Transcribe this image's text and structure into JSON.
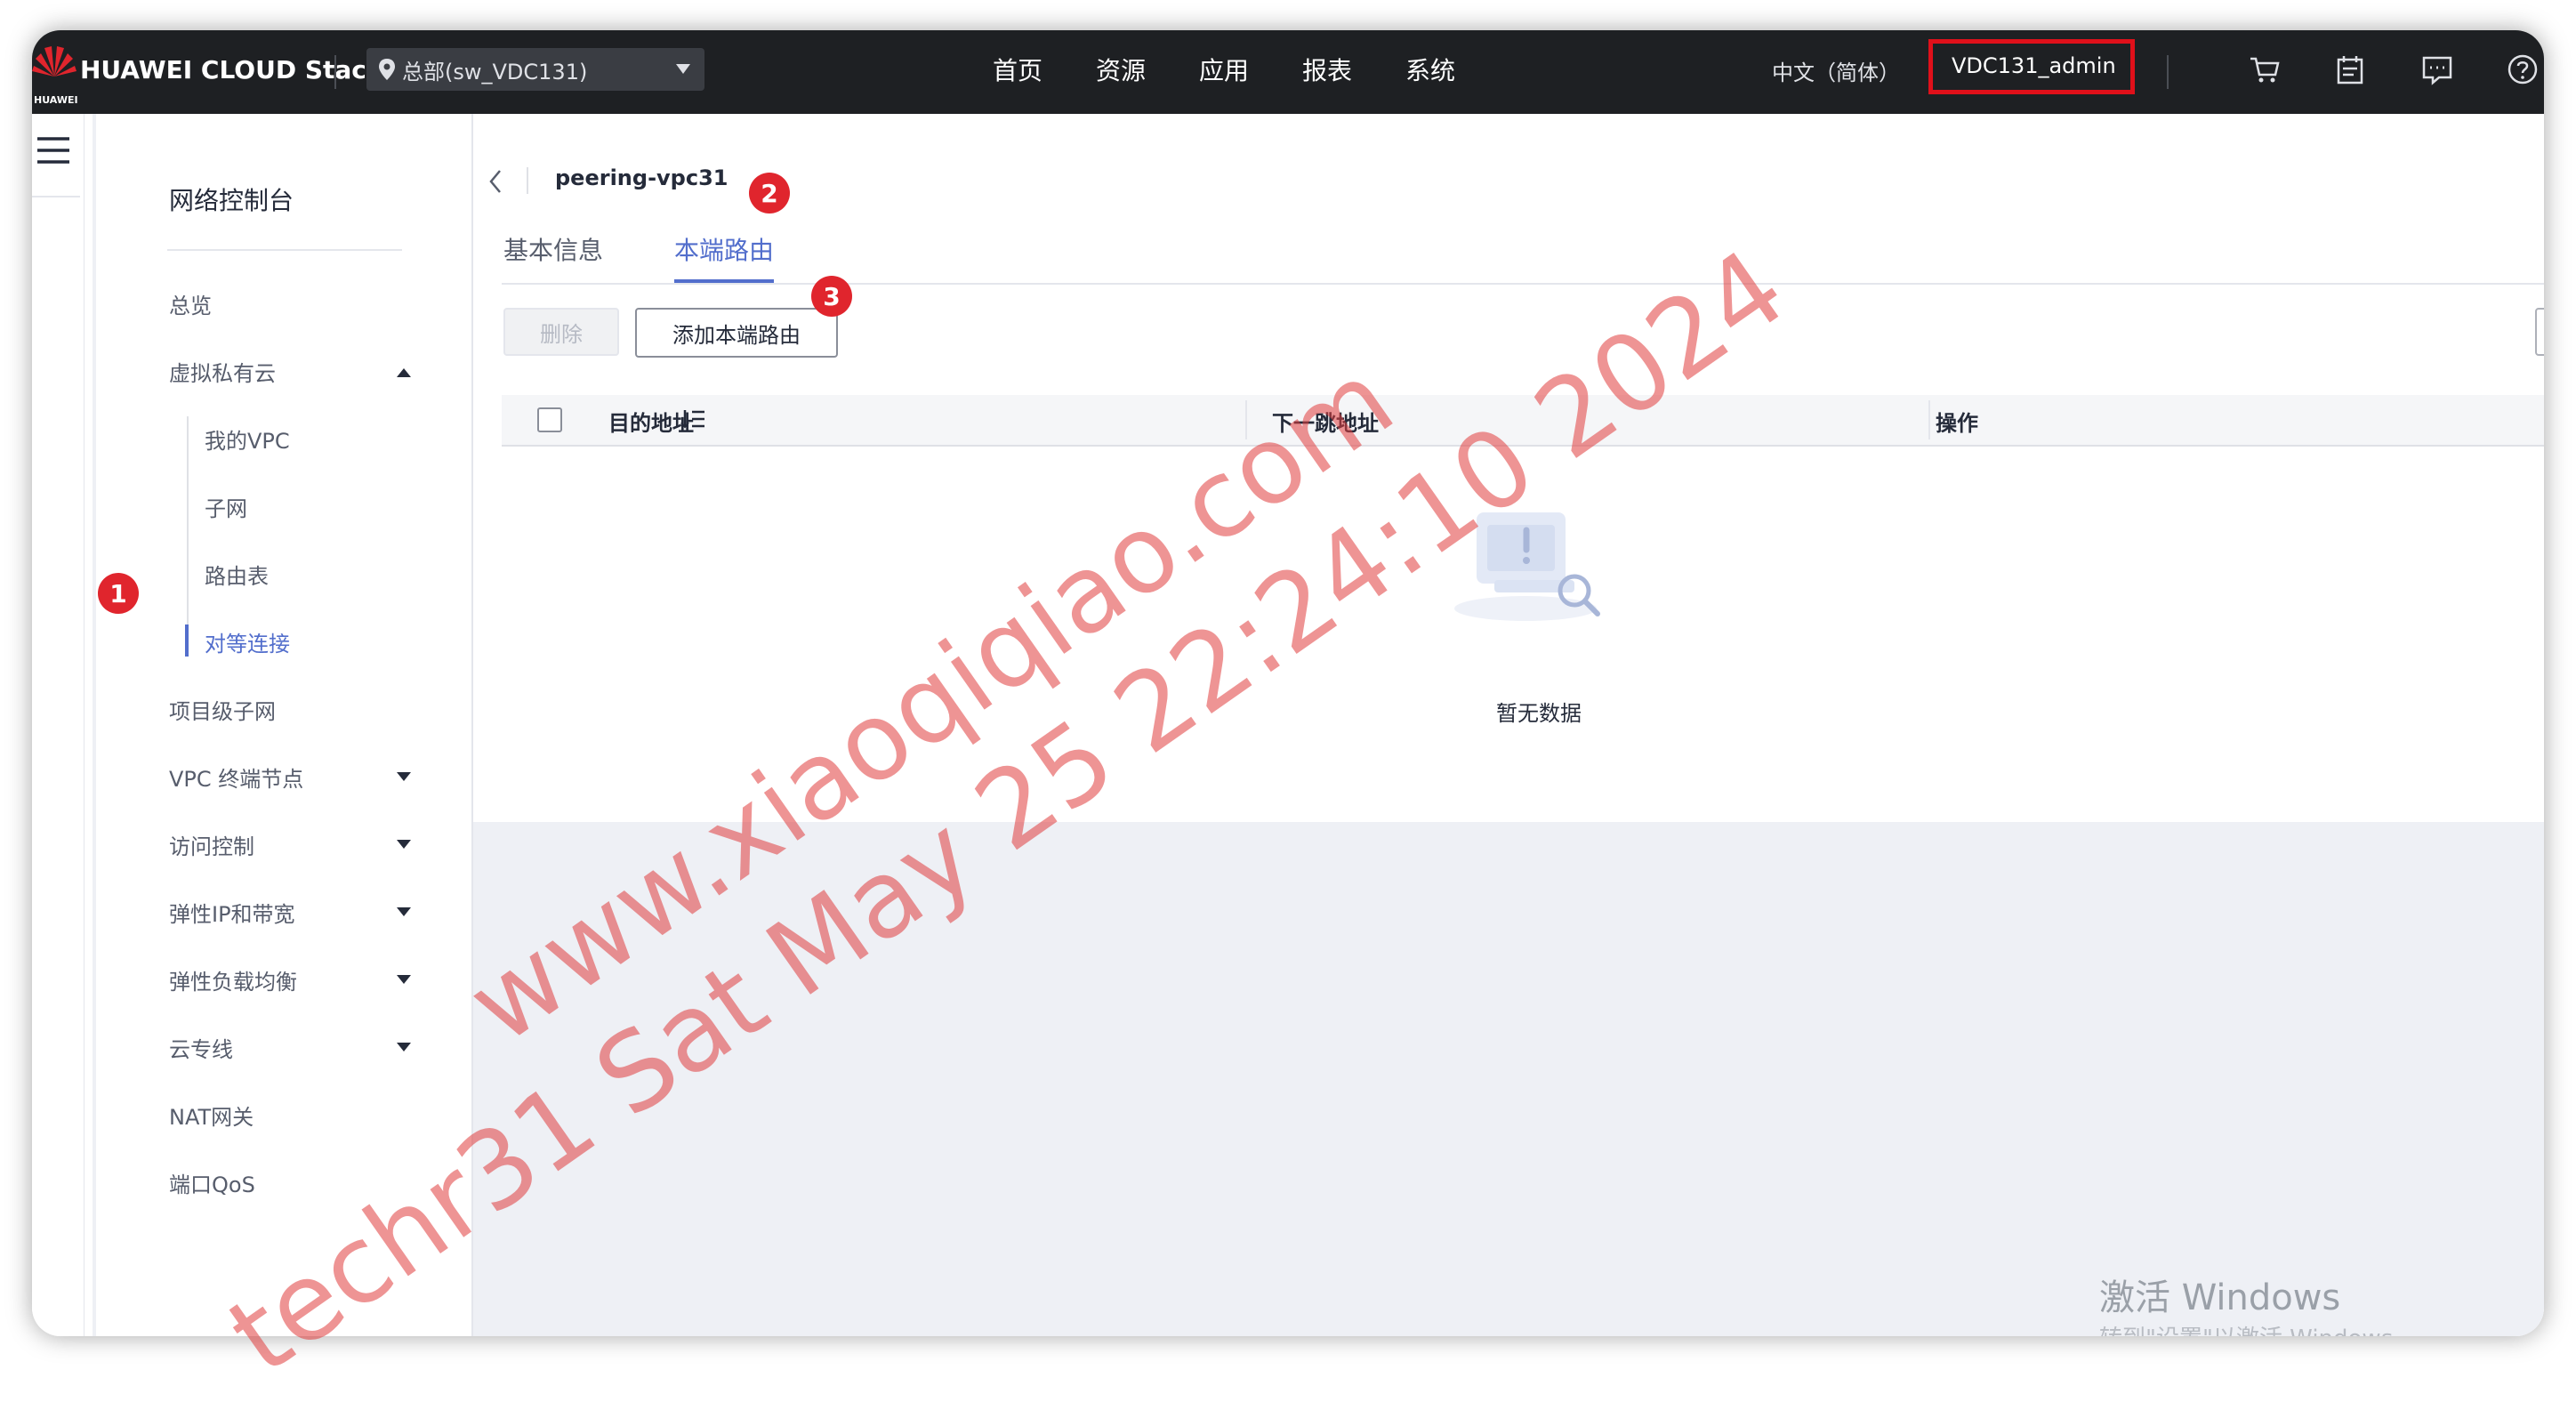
{
  "brand": {
    "logo_text": "HUAWEI CLOUD Stack",
    "logo_small": "HUAWEI",
    "colors": {
      "topbar": "#1e2023",
      "accent": "#526ecc",
      "badge": "#e0252d",
      "highlight_box": "#e0101a"
    }
  },
  "header": {
    "region": "总部(sw_VDC131)",
    "nav": [
      "首页",
      "资源",
      "应用",
      "报表",
      "系统"
    ],
    "language": "中文（简体）",
    "user": "VDC131_admin",
    "icons": [
      "cart-icon",
      "calendar-icon",
      "message-icon",
      "help-icon"
    ]
  },
  "sidebar": {
    "title": "网络控制台",
    "items": {
      "overview": "总览",
      "vpc_group": "虚拟私有云",
      "my_vpc": "我的VPC",
      "subnet": "子网",
      "route_table": "路由表",
      "peering": "对等连接",
      "project_subnet": "项目级子网",
      "vpc_endpoint": "VPC 终端节点",
      "access_control": "访问控制",
      "eip_bandwidth": "弹性IP和带宽",
      "elb": "弹性负载均衡",
      "direct_connect": "云专线",
      "nat": "NAT网关",
      "port_qos": "端口QoS"
    }
  },
  "main": {
    "page_title": "peering-vpc31",
    "tabs": [
      "基本信息",
      "本端路由"
    ],
    "active_tab": "本端路由",
    "buttons": {
      "delete": "删除",
      "add_route": "添加本端路由"
    },
    "table": {
      "columns": [
        "目的地址",
        "下一跳地址",
        "操作"
      ],
      "rows": [],
      "empty_text": "暂无数据"
    }
  },
  "annotations": {
    "badge1": "1",
    "badge2": "2",
    "badge3": "3"
  },
  "watermark": {
    "line1": "www.xiaoqiqiao.com",
    "line2": "techr31 Sat May 25 22:24:10 2024"
  },
  "windows_activation": {
    "title": "激活 Windows",
    "subtitle": "转到\"设置\"以激活 Windows。"
  }
}
